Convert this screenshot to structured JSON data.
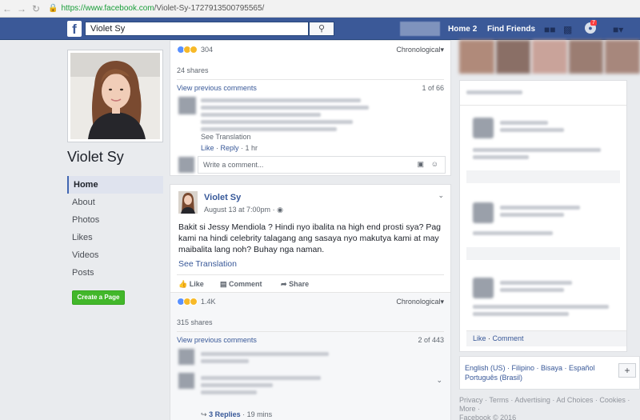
{
  "browser": {
    "url_host": "https://www.facebook.com",
    "url_rest": "/Violet-Sy-1727913500795565/"
  },
  "topbar": {
    "search_value": "Violet Sy",
    "home_label": "Home",
    "home_count": "2",
    "find_friends_label": "Find Friends",
    "notif_count": "7"
  },
  "left": {
    "page_name": "Violet Sy",
    "nav": [
      "Home",
      "About",
      "Photos",
      "Likes",
      "Videos",
      "Posts"
    ],
    "create_page_label": "Create a Page"
  },
  "post1": {
    "reaction_count": "304",
    "sort_label": "Chronological",
    "shares": "24 shares",
    "view_prev": "View previous comments",
    "comment_pager": "1 of 66",
    "see_translation": "See Translation",
    "like": "Like",
    "reply": "Reply",
    "time": "1 hr",
    "write_placeholder": "Write a comment..."
  },
  "post2": {
    "author": "Violet Sy",
    "date": "August 13 at 7:00pm",
    "text": "Bakit si Jessy Mendiola ? Hindi nyo ibalita na high end prosti sya? Pag kami na hindi celebrity talagang ang sasaya nyo makutya kami at may maibalita lang noh? Buhay nga naman.",
    "see_translation": "See Translation",
    "action_like": "Like",
    "action_comment": "Comment",
    "action_share": "Share",
    "reaction_count": "1.4K",
    "sort_label": "Chronological",
    "shares": "315 shares",
    "view_prev": "View previous comments",
    "comment_pager": "2 of 443",
    "replies": "3 Replies",
    "replies_time": "19 mins"
  },
  "right": {
    "like_label": "Like",
    "comment_label": "Comment",
    "languages_line1": "English (US) · Filipino · Bisaya · Español",
    "languages_line2": "Português (Brasil)",
    "footer_line1": "Privacy · Terms · Advertising · Ad Choices · Cookies ·",
    "footer_line2": "More ·",
    "footer_line3": "Facebook © 2016"
  },
  "colors": {
    "fb_blue": "#3b5998",
    "like_blue": "#5890ff",
    "haha_yellow": "#f7b928",
    "create_green": "#42b72a"
  }
}
